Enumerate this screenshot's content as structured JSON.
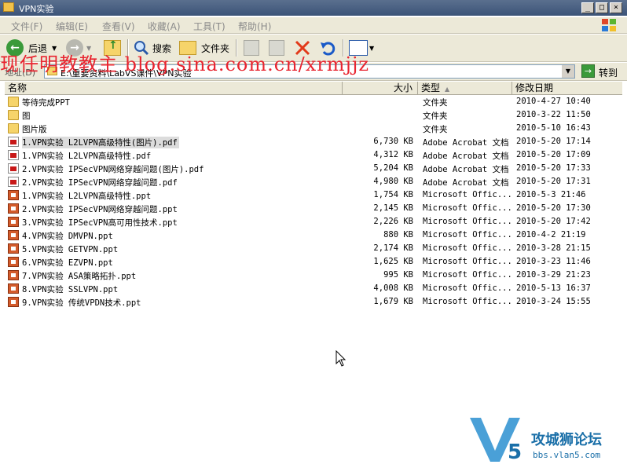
{
  "window": {
    "title": "VPN实验"
  },
  "menu": [
    "文件(F)",
    "编辑(E)",
    "查看(V)",
    "收藏(A)",
    "工具(T)",
    "帮助(H)"
  ],
  "toolbar": {
    "back": "后退",
    "search": "搜索",
    "folders": "文件夹"
  },
  "address": {
    "label": "地址(D)",
    "path": "E:\\重要资料\\LabVS课件\\VPN实验",
    "go": "转到"
  },
  "watermark": "现任明教教主 blog.sina.com.cn/xrmjjz",
  "columns": {
    "name": "名称",
    "size": "大小",
    "type": "类型",
    "modified": "修改日期"
  },
  "files": [
    {
      "name": "等待完成PPT",
      "size": "",
      "type": "文件夹",
      "date": "2010-4-27 10:40",
      "kind": "folder"
    },
    {
      "name": "图",
      "size": "",
      "type": "文件夹",
      "date": "2010-3-22 11:50",
      "kind": "folder"
    },
    {
      "name": "图片版",
      "size": "",
      "type": "文件夹",
      "date": "2010-5-10 16:43",
      "kind": "folder"
    },
    {
      "name": "1.VPN实验 L2LVPN高级特性(图片).pdf",
      "size": "6,730 KB",
      "type": "Adobe Acrobat 文档",
      "date": "2010-5-20 17:14",
      "kind": "pdf"
    },
    {
      "name": "1.VPN实验 L2LVPN高级特性.pdf",
      "size": "4,312 KB",
      "type": "Adobe Acrobat 文档",
      "date": "2010-5-20 17:09",
      "kind": "pdf"
    },
    {
      "name": "2.VPN实验 IPSecVPN网络穿越问题(图片).pdf",
      "size": "5,204 KB",
      "type": "Adobe Acrobat 文档",
      "date": "2010-5-20 17:33",
      "kind": "pdf"
    },
    {
      "name": "2.VPN实验 IPSecVPN网络穿越问题.pdf",
      "size": "4,980 KB",
      "type": "Adobe Acrobat 文档",
      "date": "2010-5-20 17:31",
      "kind": "pdf"
    },
    {
      "name": "1.VPN实验 L2LVPN高级特性.ppt",
      "size": "1,754 KB",
      "type": "Microsoft Offic...",
      "date": "2010-5-3 21:46",
      "kind": "ppt"
    },
    {
      "name": "2.VPN实验 IPSecVPN网络穿越问题.ppt",
      "size": "2,145 KB",
      "type": "Microsoft Offic...",
      "date": "2010-5-20 17:30",
      "kind": "ppt"
    },
    {
      "name": "3.VPN实验 IPSecVPN高可用性技术.ppt",
      "size": "2,226 KB",
      "type": "Microsoft Offic...",
      "date": "2010-5-20 17:42",
      "kind": "ppt"
    },
    {
      "name": "4.VPN实验 DMVPN.ppt",
      "size": "880 KB",
      "type": "Microsoft Offic...",
      "date": "2010-4-2 21:19",
      "kind": "ppt"
    },
    {
      "name": "5.VPN实验 GETVPN.ppt",
      "size": "2,174 KB",
      "type": "Microsoft Offic...",
      "date": "2010-3-28 21:15",
      "kind": "ppt"
    },
    {
      "name": "6.VPN实验 EZVPN.ppt",
      "size": "1,625 KB",
      "type": "Microsoft Offic...",
      "date": "2010-3-23 11:46",
      "kind": "ppt"
    },
    {
      "name": "7.VPN实验 ASA策略拓扑.ppt",
      "size": "995 KB",
      "type": "Microsoft Offic...",
      "date": "2010-3-29 21:23",
      "kind": "ppt"
    },
    {
      "name": "8.VPN实验 SSLVPN.ppt",
      "size": "4,008 KB",
      "type": "Microsoft Offic...",
      "date": "2010-5-13 16:37",
      "kind": "ppt"
    },
    {
      "name": "9.VPN实验 传统VPDN技术.ppt",
      "size": "1,679 KB",
      "type": "Microsoft Offic...",
      "date": "2010-3-24 15:55",
      "kind": "ppt"
    }
  ],
  "logo": {
    "brand": "攻城狮论坛",
    "url": "bbs.vlan5.com"
  },
  "colors": {
    "titlebar": "#3c5478",
    "watermark": "#e8242f",
    "logo": "#1a6fa8"
  },
  "icons": {
    "folder": "folder-icon",
    "pdf": "pdf-file-icon",
    "ppt": "ppt-file-icon"
  }
}
